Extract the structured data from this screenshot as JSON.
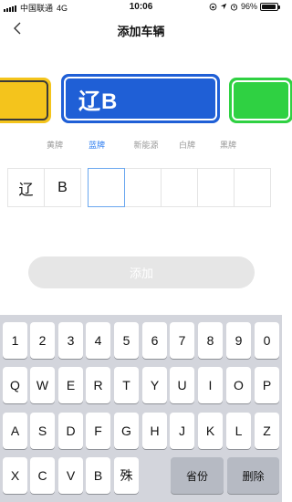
{
  "status": {
    "carrier": "中国联通",
    "network": "4G",
    "time": "10:06",
    "battery_percent": "96%",
    "battery_level": 0.96,
    "icons": [
      "orientation-lock-icon",
      "location-icon",
      "alarm-icon",
      "battery-icon"
    ]
  },
  "nav": {
    "back_icon": "chevron-left-icon",
    "title": "添加车辆"
  },
  "plate_display": {
    "text": "辽B",
    "colors": {
      "yellow": "#f4c41c",
      "blue": "#1f5fd6",
      "green": "#2fd142"
    }
  },
  "plate_types": [
    {
      "label": "黄牌",
      "active": false
    },
    {
      "label": "蓝牌",
      "active": true
    },
    {
      "label": "新能源",
      "active": false
    },
    {
      "label": "白牌",
      "active": false
    },
    {
      "label": "黑牌",
      "active": false
    }
  ],
  "accent": "#2f7ef0",
  "plate_chars": [
    "辽",
    "B",
    "",
    "",
    "",
    "",
    ""
  ],
  "add_button": {
    "label": "添加"
  },
  "keyboard": {
    "row1": [
      "1",
      "2",
      "3",
      "4",
      "5",
      "6",
      "7",
      "8",
      "9",
      "0"
    ],
    "row2": [
      "Q",
      "W",
      "E",
      "R",
      "T",
      "Y",
      "U",
      "I",
      "O",
      "P"
    ],
    "row3": [
      "A",
      "S",
      "D",
      "F",
      "G",
      "H",
      "J",
      "K",
      "L",
      "Z"
    ],
    "row4": [
      "X",
      "C",
      "V",
      "B",
      "殊"
    ],
    "province_label": "省份",
    "delete_label": "删除"
  }
}
